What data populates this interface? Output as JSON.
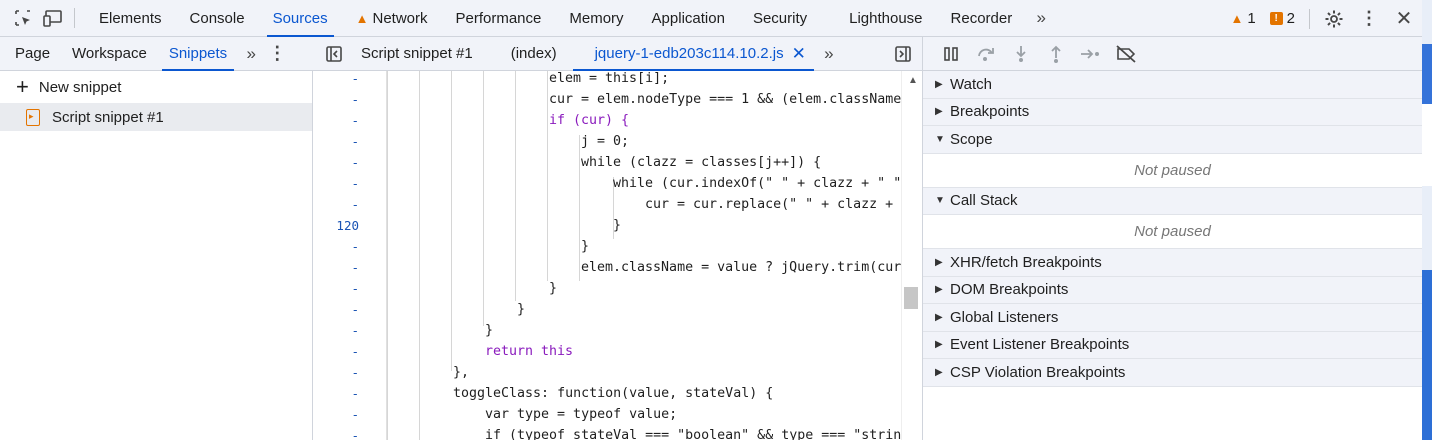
{
  "toolbar": {
    "tabs": [
      {
        "label": "Elements"
      },
      {
        "label": "Console"
      },
      {
        "label": "Sources"
      },
      {
        "label": "Network"
      },
      {
        "label": "Performance"
      },
      {
        "label": "Memory"
      },
      {
        "label": "Application"
      },
      {
        "label": "Security"
      },
      {
        "label": "Lighthouse"
      },
      {
        "label": "Recorder"
      }
    ],
    "active_tab": "Sources",
    "warnings_count": "1",
    "issues_count": "2"
  },
  "navigator": {
    "tabs": [
      {
        "label": "Page"
      },
      {
        "label": "Workspace"
      },
      {
        "label": "Snippets"
      }
    ],
    "active_tab": "Snippets",
    "new_snippet_label": "New snippet",
    "snippets": [
      {
        "label": "Script snippet #1"
      }
    ]
  },
  "editor": {
    "tabs": [
      {
        "label": "Script snippet #1"
      },
      {
        "label": "(index)"
      },
      {
        "label": "jquery-1-edb203c114.10.2.js"
      }
    ],
    "active_tab": "jquery-1-edb203c114.10.2.js",
    "line_numbers": [
      "-",
      "-",
      "-",
      "-",
      "-",
      "-",
      "-",
      "120",
      "-",
      "-",
      "-",
      "-",
      "-",
      "-",
      "-",
      "-",
      "-",
      "-"
    ],
    "code_lines": [
      "elem = this[i];",
      "cur = elem.nodeType === 1 && (elem.className",
      "if (cur) {",
      "j = 0;",
      "while (clazz = classes[j++]) {",
      "while (cur.indexOf(\" \" + clazz + \" \"",
      "cur = cur.replace(\" \" + clazz +",
      "}",
      "}",
      "elem.className = value ? jQuery.trim(cur",
      "}",
      "}",
      "}",
      "return this",
      "},",
      "toggleClass: function(value, stateVal) {",
      "var type = typeof value;",
      "if (typeof stateVal === \"boolean\" && type === \"strin"
    ]
  },
  "debugger": {
    "sections": {
      "watch": "Watch",
      "breakpoints": "Breakpoints",
      "scope": "Scope",
      "scope_body": "Not paused",
      "call_stack": "Call Stack",
      "call_stack_body": "Not paused",
      "xhr": "XHR/fetch Breakpoints",
      "dom": "DOM Breakpoints",
      "global": "Global Listeners",
      "event": "Event Listener Breakpoints",
      "csp": "CSP Violation Breakpoints"
    }
  },
  "colors": {
    "accent": "#0b57d0",
    "warning": "#e37400",
    "toolbar_bg": "#f1f3f9"
  }
}
